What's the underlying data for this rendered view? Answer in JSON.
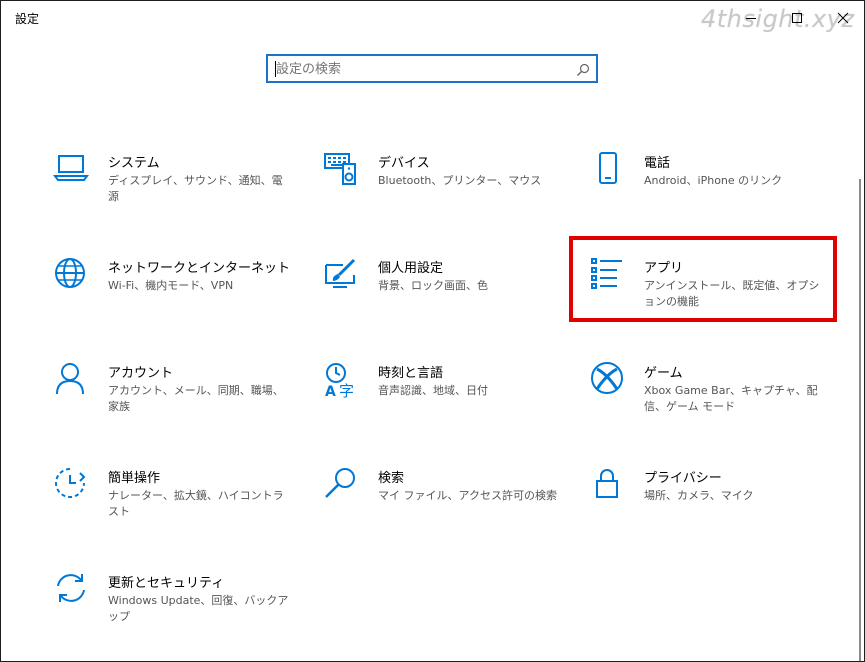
{
  "window": {
    "title": "設定",
    "watermark": "4thsight.xyz"
  },
  "search": {
    "placeholder": "設定の検索"
  },
  "accent": "#0078d7",
  "highlight_color": "#e00000",
  "tiles": [
    {
      "name": "システム",
      "desc": "ディスプレイ、サウンド、通知、電源",
      "icon": "laptop-icon"
    },
    {
      "name": "デバイス",
      "desc": "Bluetooth、プリンター、マウス",
      "icon": "keyboard-speaker-icon"
    },
    {
      "name": "電話",
      "desc": "Android、iPhone のリンク",
      "icon": "phone-icon"
    },
    {
      "name": "ネットワークとインターネット",
      "desc": "Wi-Fi、機内モード、VPN",
      "icon": "globe-icon"
    },
    {
      "name": "個人用設定",
      "desc": "背景、ロック画面、色",
      "icon": "paintbrush-icon"
    },
    {
      "name": "アプリ",
      "desc": "アンインストール、既定値、オプションの機能",
      "icon": "app-list-icon"
    },
    {
      "name": "アカウント",
      "desc": "アカウント、メール、同期、職場、家族",
      "icon": "person-icon"
    },
    {
      "name": "時刻と言語",
      "desc": "音声認識、地域、日付",
      "icon": "time-language-icon"
    },
    {
      "name": "ゲーム",
      "desc": "Xbox Game Bar、キャプチャ、配信、ゲーム モード",
      "icon": "xbox-icon"
    },
    {
      "name": "簡単操作",
      "desc": "ナレーター、拡大鏡、ハイコントラスト",
      "icon": "ease-of-access-icon"
    },
    {
      "name": "検索",
      "desc": "マイ ファイル、アクセス許可の検索",
      "icon": "magnifier-icon"
    },
    {
      "name": "プライバシー",
      "desc": "場所、カメラ、マイク",
      "icon": "lock-icon"
    },
    {
      "name": "更新とセキュリティ",
      "desc": "Windows Update、回復、バックアップ",
      "icon": "sync-icon"
    }
  ]
}
